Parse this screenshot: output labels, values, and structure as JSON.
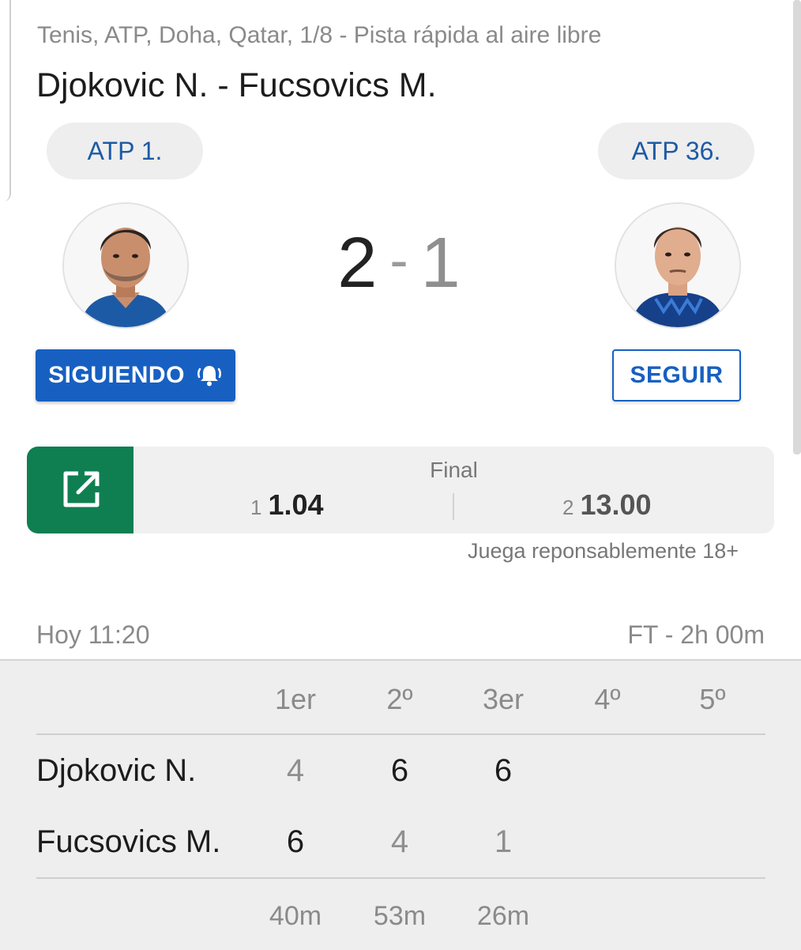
{
  "match": {
    "competition": "Tenis, ATP, Doha, Qatar, 1/8 - Pista rápida al aire libre",
    "title": "Djokovic N. - Fucsovics M."
  },
  "home": {
    "ranking": "ATP 1.",
    "score": "2",
    "follow_label": "SIGUIENDO"
  },
  "away": {
    "ranking": "ATP 36.",
    "score": "1",
    "follow_label": "SEGUIR"
  },
  "score_separator": "-",
  "odds": {
    "label": "Final",
    "home_index": "1",
    "home_value": "1.04",
    "away_index": "2",
    "away_value": "13.00",
    "disclaimer": "Juega reponsablemente 18+",
    "accent_color": "#0f7f52"
  },
  "info": {
    "start_time": "Hoy 11:20",
    "status": "FT - 2h 00m"
  },
  "sets": {
    "headers": [
      "1er",
      "2º",
      "3er",
      "4º",
      "5º"
    ],
    "rows": [
      {
        "player": "Djokovic N.",
        "scores": [
          "4",
          "6",
          "6"
        ]
      },
      {
        "player": "Fucsovics M.",
        "scores": [
          "6",
          "4",
          "1"
        ]
      }
    ],
    "durations": [
      "40m",
      "53m",
      "26m"
    ]
  },
  "icons": {
    "follow_active": "bell-ringing-icon",
    "odds_link": "open-in-new-icon"
  },
  "colors": {
    "primary": "#1760c2",
    "ranking_text": "#1d5aa6"
  }
}
